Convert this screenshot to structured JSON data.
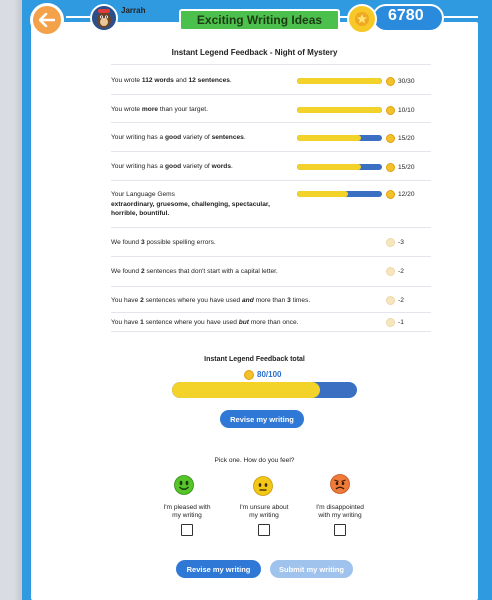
{
  "header": {
    "username": "Jarrah",
    "title": "Exciting Writing Ideas",
    "coins": "6780"
  },
  "feedback": {
    "title": "Instant Legend Feedback - Night of Mystery",
    "rows": [
      {
        "parts": [
          "You wrote ",
          "112 words",
          " and ",
          "12 sentences",
          "."
        ],
        "bar": 1.0,
        "score": "30/30"
      },
      {
        "parts": [
          "You wrote ",
          "more",
          " than your target."
        ],
        "bar": 1.0,
        "score": "10/10"
      },
      {
        "parts": [
          "Your writing has a ",
          "good",
          " variety of ",
          "sentences",
          "."
        ],
        "bar": 0.75,
        "score": "15/20"
      },
      {
        "parts": [
          "Your writing has a ",
          "good",
          " variety of ",
          "words",
          "."
        ],
        "bar": 0.75,
        "score": "15/20"
      },
      {
        "line1": "Your Language Gems",
        "line2": "extraordinary, gruesome, challenging, spectacular,",
        "line3": "horrible, bountiful.",
        "bar": 0.6,
        "score": "12/20"
      },
      {
        "parts": [
          "We found ",
          "3",
          " possible spelling errors."
        ],
        "score": "-3"
      },
      {
        "parts": [
          "We found ",
          "2",
          " sentences that don't start with a capital letter."
        ],
        "score": "-2"
      },
      {
        "parts": [
          "You have ",
          "2",
          " sentences where you have used ",
          "and",
          " more than ",
          "3",
          " times."
        ],
        "score": "-2"
      },
      {
        "parts": [
          "You have ",
          "1",
          " sentence where you have used ",
          "but",
          " more than once."
        ],
        "score": "-1"
      }
    ]
  },
  "total": {
    "label": "Instant Legend Feedback total",
    "score": "80/100",
    "progress": 0.8
  },
  "buttons": {
    "revise": "Revise my writing",
    "revise_bottom": "Revise my writing",
    "submit": "Submit my writing"
  },
  "feelings": {
    "prompt": "Pick one. How do you feel?",
    "options": [
      {
        "label1": "I'm pleased with",
        "label2": "my writing",
        "color": "#55c52a"
      },
      {
        "label1": "I'm unsure about",
        "label2": "my writing",
        "color": "#f2c718"
      },
      {
        "label1": "I'm disappointed",
        "label2": "with my writing",
        "color": "#f07a3a"
      }
    ]
  },
  "colors": {
    "frame": "#2f9ae0",
    "accent": "#2f78d6",
    "bar_fill": "#f3d22a",
    "bar_track": "#3a6fc2",
    "title_green": "#4cc04c"
  }
}
